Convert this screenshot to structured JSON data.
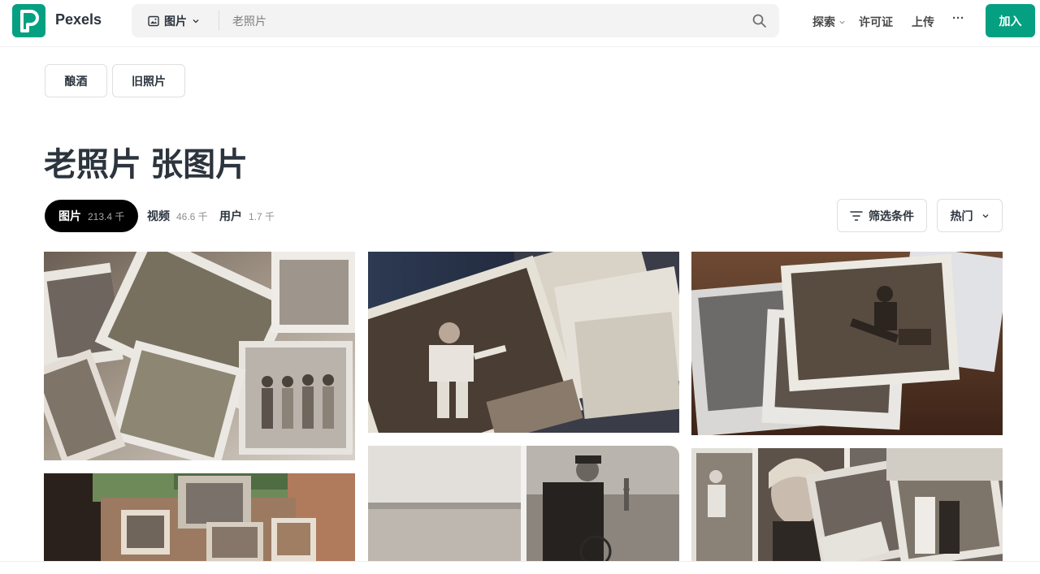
{
  "header": {
    "brand": "Pexels",
    "search": {
      "type_label": "图片",
      "placeholder": "老照片",
      "value": ""
    },
    "nav": {
      "explore": "探索",
      "license": "许可证",
      "upload": "上传",
      "more": "···",
      "join": "加入"
    }
  },
  "related_chips": [
    "酿酒",
    "旧照片"
  ],
  "title": "老照片 张图片",
  "tabs": [
    {
      "label": "图片",
      "count": "213.4 千"
    },
    {
      "label": "视频",
      "count": "46.6 千"
    },
    {
      "label": "用户",
      "count": "1.7 千"
    }
  ],
  "filters": {
    "filter_label": "筛选条件",
    "sort_label": "热门"
  },
  "photos": [
    {
      "id": "scattered-children-photos",
      "icon": "photo-image"
    },
    {
      "id": "boy-sailor-suit-photo",
      "icon": "photo-image"
    },
    {
      "id": "stack-portrait-photos",
      "icon": "photo-image"
    },
    {
      "id": "box-of-old-photos",
      "icon": "photo-image"
    },
    {
      "id": "sea-and-man-with-bicycle",
      "icon": "photo-image"
    },
    {
      "id": "girl-portrait-photos",
      "icon": "photo-image"
    }
  ],
  "colors": {
    "brand": "#05a081",
    "text": "#2c343e",
    "active_tab_bg": "#000000"
  }
}
